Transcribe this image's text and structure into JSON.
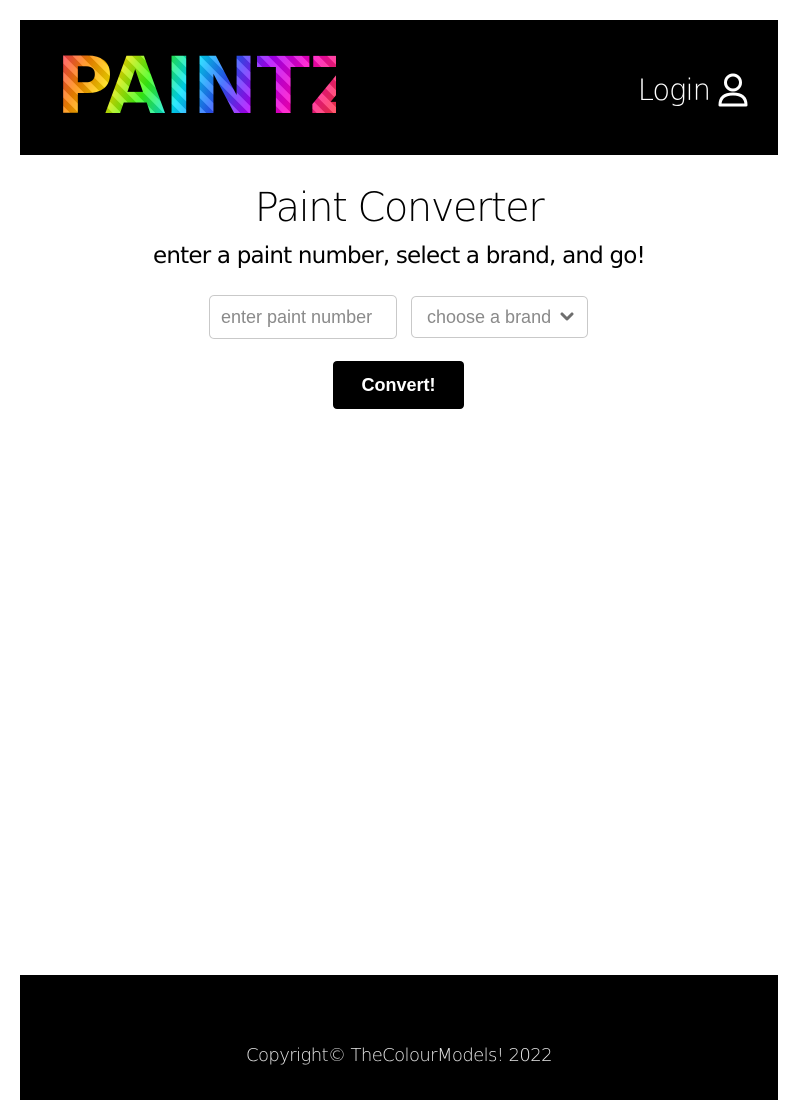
{
  "header": {
    "logo_text": "PAINTZ!",
    "login_label": "Login",
    "login_icon": "user-icon"
  },
  "main": {
    "title": "Paint Converter",
    "subtitle": "enter a paint number, select a brand, and go!",
    "paint_input": {
      "value": "",
      "placeholder": "enter paint number"
    },
    "brand_select": {
      "selected": "choose a brand",
      "icon": "chevron-down-icon"
    },
    "convert_label": "Convert!"
  },
  "footer": {
    "copyright": "Copyright© TheColourModels! 2022"
  },
  "colors": {
    "header_bg": "#000000",
    "footer_bg": "#000000",
    "button_bg": "#000000",
    "page_bg": "#ffffff"
  }
}
